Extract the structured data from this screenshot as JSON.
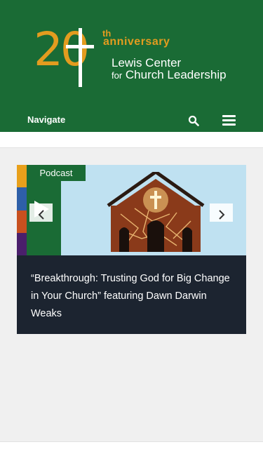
{
  "header": {
    "logo": {
      "number": "20",
      "superscript": "th",
      "anniversary": "anniversary",
      "line1": "Lewis Center",
      "line2_small": "for",
      "line2": "Church Leadership"
    },
    "nav_label": "Navigate",
    "search_icon": "search-icon",
    "menu_icon": "hamburger-menu-icon"
  },
  "carousel": {
    "tag": "Podcast",
    "title": "“Breakthrough: Trusting God for Big Change in Your Church” featuring Dawn Darwin Weaks",
    "prev_icon": "chevron-left-icon",
    "next_icon": "chevron-right-icon",
    "play_icon": "play-icon"
  },
  "colors": {
    "brand_green": "#1a6b35",
    "accent_gold": "#e39c1f",
    "card_dark": "#1c2430",
    "stripes": [
      "#e8a01b",
      "#2e5fa8",
      "#c8501f",
      "#4a1f6b"
    ]
  }
}
